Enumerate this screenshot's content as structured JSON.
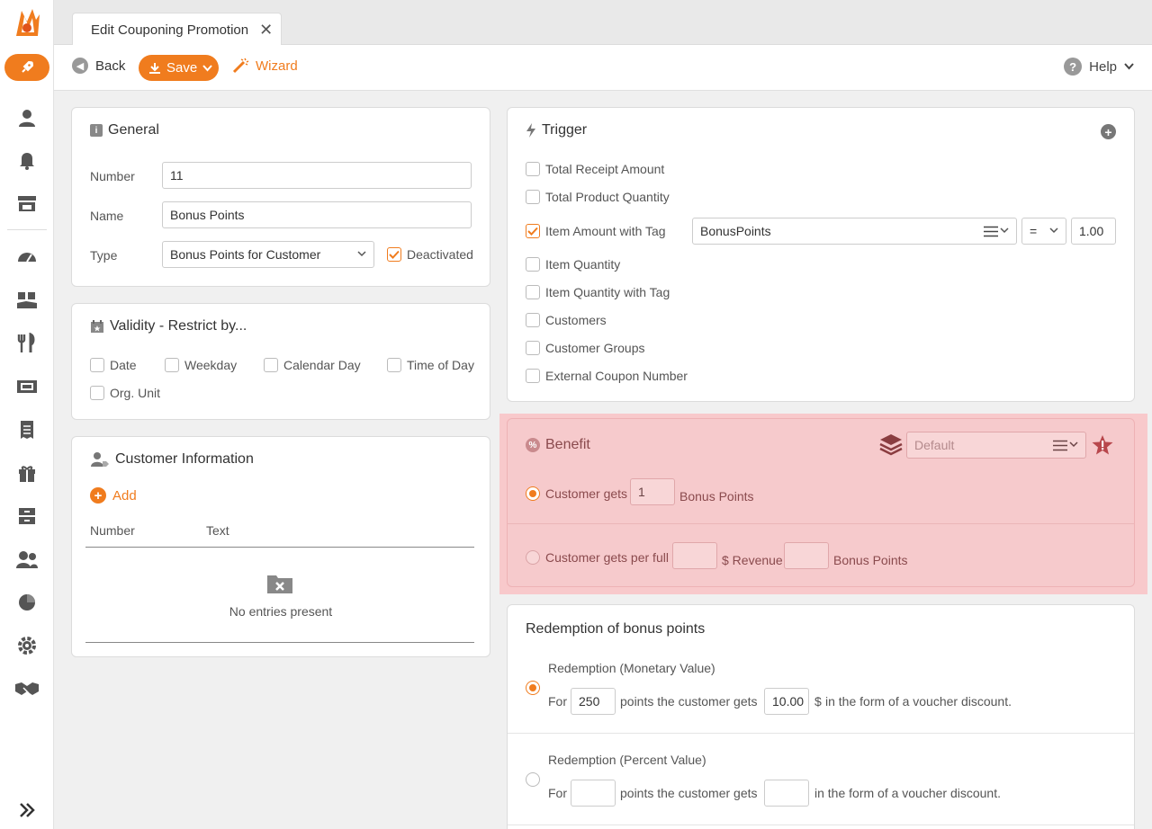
{
  "tab": {
    "title": "Edit Couponing Promotion"
  },
  "toolbar": {
    "back": "Back",
    "save": "Save",
    "wizard": "Wizard",
    "help": "Help"
  },
  "general": {
    "title": "General",
    "number_label": "Number",
    "number_value": "11",
    "name_label": "Name",
    "name_value": "Bonus Points",
    "type_label": "Type",
    "type_value": "Bonus Points for Customer",
    "deactivated_label": "Deactivated"
  },
  "validity": {
    "title": "Validity - Restrict by...",
    "options": [
      "Date",
      "Weekday",
      "Calendar Day",
      "Time of Day",
      "Org. Unit"
    ]
  },
  "customer_info": {
    "title": "Customer Information",
    "add": "Add",
    "col_number": "Number",
    "col_text": "Text",
    "empty": "No entries present"
  },
  "trigger": {
    "title": "Trigger",
    "options": [
      "Total Receipt Amount",
      "Total Product Quantity",
      "Item Amount with Tag",
      "Item Quantity",
      "Item Quantity with Tag",
      "Customers",
      "Customer Groups",
      "External Coupon Number"
    ],
    "tag_value": "BonusPoints",
    "operator": "=",
    "amount": "1.00"
  },
  "benefit": {
    "title": "Benefit",
    "layer_placeholder": "Default",
    "opt1_prefix": "Customer gets",
    "opt1_value": "1",
    "opt1_suffix": "Bonus Points",
    "opt2_prefix": "Customer gets per full",
    "opt2_mid": "$ Revenue",
    "opt2_suffix": "Bonus Points"
  },
  "redemption": {
    "title": "Redemption of bonus points",
    "monetary_title": "Redemption (Monetary Value)",
    "percent_title": "Redemption (Percent Value)",
    "for": "For",
    "points_text": "points the customer gets",
    "monetary_points": "250",
    "monetary_value": "10.00",
    "currency": "$",
    "discount_text": "in the form of a voucher discount."
  },
  "colors": {
    "accent": "#f07c1e",
    "benefit_bg": "#f6cacc"
  }
}
